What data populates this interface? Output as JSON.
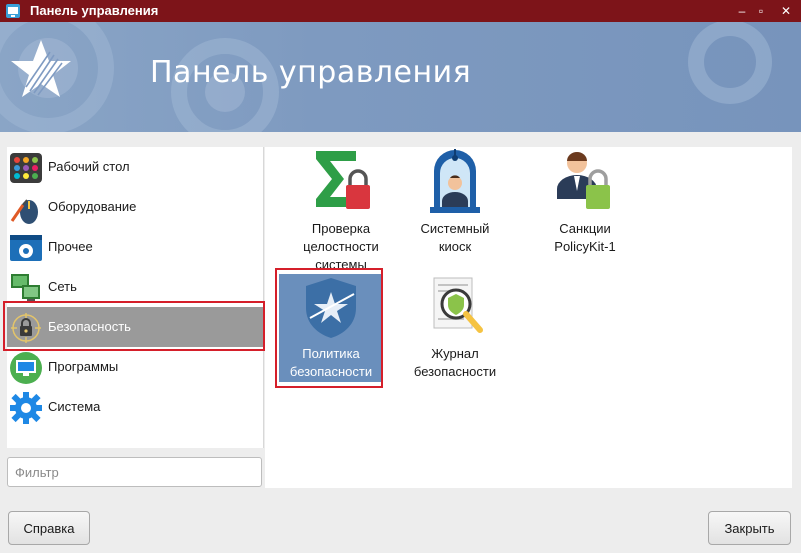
{
  "window": {
    "title": "Панель управления",
    "controls": {
      "minimize": "–",
      "maximize": "▫",
      "close": "✕"
    }
  },
  "banner": {
    "title": "Панель управления"
  },
  "sidebar": {
    "items": [
      {
        "label": "Рабочий стол",
        "icon": "desktop-palette-icon"
      },
      {
        "label": "Оборудование",
        "icon": "hardware-mouse-icon"
      },
      {
        "label": "Прочее",
        "icon": "misc-gear-window-icon"
      },
      {
        "label": "Сеть",
        "icon": "network-monitors-icon"
      },
      {
        "label": "Безопасность",
        "icon": "security-lock-icon",
        "selected": true
      },
      {
        "label": "Программы",
        "icon": "programs-monitor-icon"
      },
      {
        "label": "Система",
        "icon": "system-gear-icon"
      }
    ]
  },
  "filter": {
    "placeholder": "Фильтр",
    "value": ""
  },
  "main": {
    "tiles": [
      {
        "label": "Проверка целостности системы",
        "icon": "integrity-sigma-lock-icon"
      },
      {
        "label": "Системный киоск",
        "icon": "kiosk-person-icon"
      },
      {
        "label": "Санкции PolicyKit-1",
        "icon": "policykit-person-lock-icon"
      },
      {
        "label": "Политика безопасности",
        "icon": "security-policy-shield-icon",
        "selected": true
      },
      {
        "label": "Журнал безопасности",
        "icon": "security-log-magnifier-icon"
      }
    ]
  },
  "buttons": {
    "help": "Справка",
    "close": "Закрыть"
  },
  "colors": {
    "titlebar": "#7d1419",
    "banner": "#7e9ac0",
    "selection": "#6a8fbc",
    "highlight_frame": "#d51f2a"
  }
}
